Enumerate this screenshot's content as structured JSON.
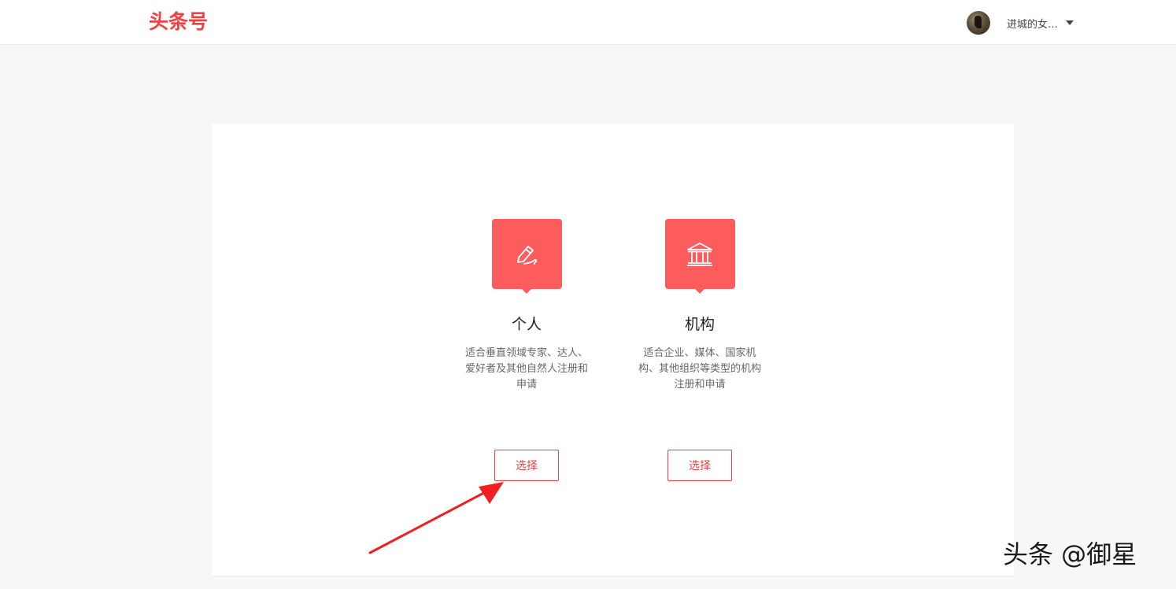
{
  "header": {
    "logo": "头条号",
    "user": {
      "name": "进城的女…",
      "avatar_icon": "avatar-photo",
      "caret_icon": "caret-down-icon"
    }
  },
  "options": [
    {
      "icon": "pen-icon",
      "title": "个人",
      "description": "适合垂直领域专家、达人、爱好者及其他自然人注册和申请",
      "button_label": "选择"
    },
    {
      "icon": "institution-building-icon",
      "title": "机构",
      "description": "适合企业、媒体、国家机构、其他组织等类型的机构注册和申请",
      "button_label": "选择"
    }
  ],
  "annotation": {
    "arrow_color": "#f02020"
  },
  "watermark": "头条 @御星",
  "colors": {
    "brand": "#f04142",
    "icon_bg": "#fd5c5c",
    "page_bg": "#f7f7f7"
  }
}
